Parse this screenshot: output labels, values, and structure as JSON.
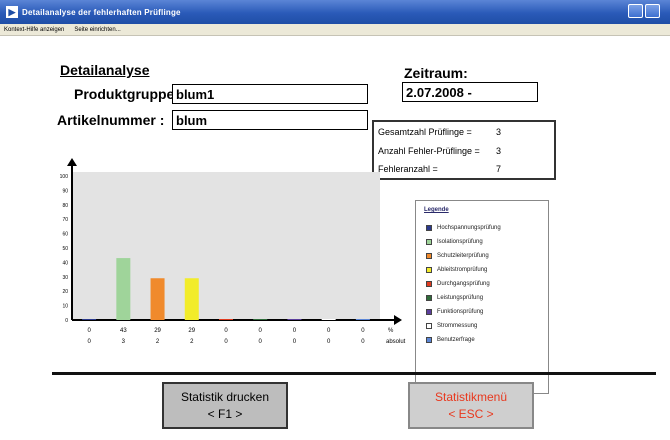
{
  "window": {
    "title": "Detailanalyse der fehlerhaften Prüflinge"
  },
  "menu": {
    "items": [
      "Kontext-Hilfe anzeigen",
      "Seite einrichten..."
    ]
  },
  "header": {
    "heading": "Detailanalyse",
    "produktgruppe_label": "Produktgruppe :",
    "produktgruppe_value": "blum1",
    "artikelnummer_label": "Artikelnummer :",
    "artikelnummer_value": "blum",
    "zeitraum_label": "Zeitraum:",
    "zeitraum_value": "2.07.2008 -"
  },
  "stats": [
    {
      "label": "Gesamtzahl Prüflinge =",
      "value": "3"
    },
    {
      "label": "Anzahl Fehler-Prüflinge =",
      "value": "3"
    },
    {
      "label": "Fehleranzahl =",
      "value": "7"
    }
  ],
  "chart_data": {
    "type": "bar",
    "categories": [
      "Hochspannungsprüfung",
      "Isolationsprüfung",
      "Schutzleiterprüfung",
      "Ableitstromprüfung",
      "Durchgangsprüfung",
      "Leistungsprüfung",
      "Funktionsprüfung",
      "Strommessung",
      "Benutzerfrage"
    ],
    "values": [
      0,
      43,
      29,
      29,
      0,
      0,
      0,
      0,
      0
    ],
    "percent_labels": [
      "0",
      "43",
      "29",
      "29",
      "0",
      "0",
      "0",
      "0",
      "0"
    ],
    "absolute_labels": [
      "0",
      "3",
      "2",
      "2",
      "0",
      "0",
      "0",
      "0",
      "0"
    ],
    "colors": [
      "#2b3a8c",
      "#9fd49a",
      "#f08a2c",
      "#f2ec2a",
      "#e03b1f",
      "#2f6b3a",
      "#5b3e9c",
      "#ffffff",
      "#5b86d6"
    ],
    "ylim": [
      0,
      100
    ],
    "yticks": [
      0,
      10,
      20,
      30,
      40,
      50,
      60,
      70,
      80,
      90,
      100
    ],
    "row_labels": {
      "percent": "%",
      "absolute": "absolut"
    }
  },
  "legend": {
    "title": "Legende",
    "items": [
      "Hochspannungsprüfung",
      "Isolationsprüfung",
      "Schutzleiterprüfung",
      "Ableitstromprüfung",
      "Durchgangsprüfung",
      "Leistungsprüfung",
      "Funktionsprüfung",
      "Strommessung",
      "Benutzerfrage"
    ]
  },
  "buttons": {
    "print": {
      "line1": "Statistik drucken",
      "line2": "< F1 >"
    },
    "menu": {
      "line1": "Statistikmenü",
      "line2": "< ESC >"
    }
  }
}
